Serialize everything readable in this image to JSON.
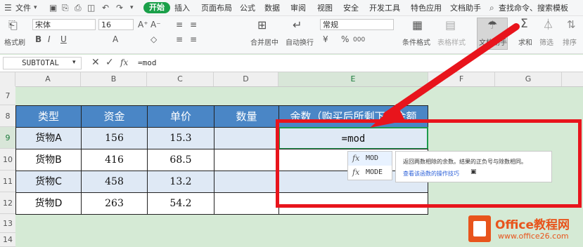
{
  "menu": {
    "file": "文件",
    "start": "开始",
    "items": [
      "插入",
      "页面布局",
      "公式",
      "数据",
      "审阅",
      "视图",
      "安全",
      "开发工具",
      "特色应用",
      "文档助手"
    ],
    "search": "查找命令、搜索模板"
  },
  "toolbar": {
    "format_painter": "格式刷",
    "font": "宋体",
    "font_size": "16",
    "merge_center": "合并居中",
    "wrap_text": "自动换行",
    "number_format": "常规",
    "percent": "%",
    "thousands": "000",
    "conditional_format": "条件格式",
    "table_style": "表格样式",
    "doc_assistant": "文档助手",
    "sum": "求和",
    "filter": "筛选",
    "sort": "排序"
  },
  "formula_bar": {
    "name_box": "SUBTOTAL",
    "fx": "fx",
    "formula": "=mod"
  },
  "columns": [
    "A",
    "B",
    "C",
    "D",
    "E",
    "F",
    "G"
  ],
  "rows": [
    "7",
    "8",
    "9",
    "10",
    "11",
    "12",
    "13",
    "14"
  ],
  "table": {
    "headers": [
      "类型",
      "资金",
      "单价",
      "数量",
      "余数（购买后所剩下的金额"
    ],
    "rows": [
      [
        "货物A",
        "156",
        "15.3",
        "",
        "=mod"
      ],
      [
        "货物B",
        "416",
        "68.5",
        "",
        ""
      ],
      [
        "货物C",
        "458",
        "13.2",
        "",
        ""
      ],
      [
        "货物D",
        "263",
        "54.2",
        "",
        ""
      ]
    ]
  },
  "autocomplete": {
    "items": [
      "MOD",
      "MODE"
    ],
    "description": "返回两数相除的余数。结果的正负号与除数相同。",
    "link": "查看该函数的操作技巧"
  },
  "watermark": {
    "brand": "Office教程网",
    "url": "www.office26.com"
  },
  "colors": {
    "accent_green": "#1aa049",
    "header_blue": "#4a86c6",
    "highlight_red": "#e8141c",
    "sheet_green": "#d5ead5"
  }
}
